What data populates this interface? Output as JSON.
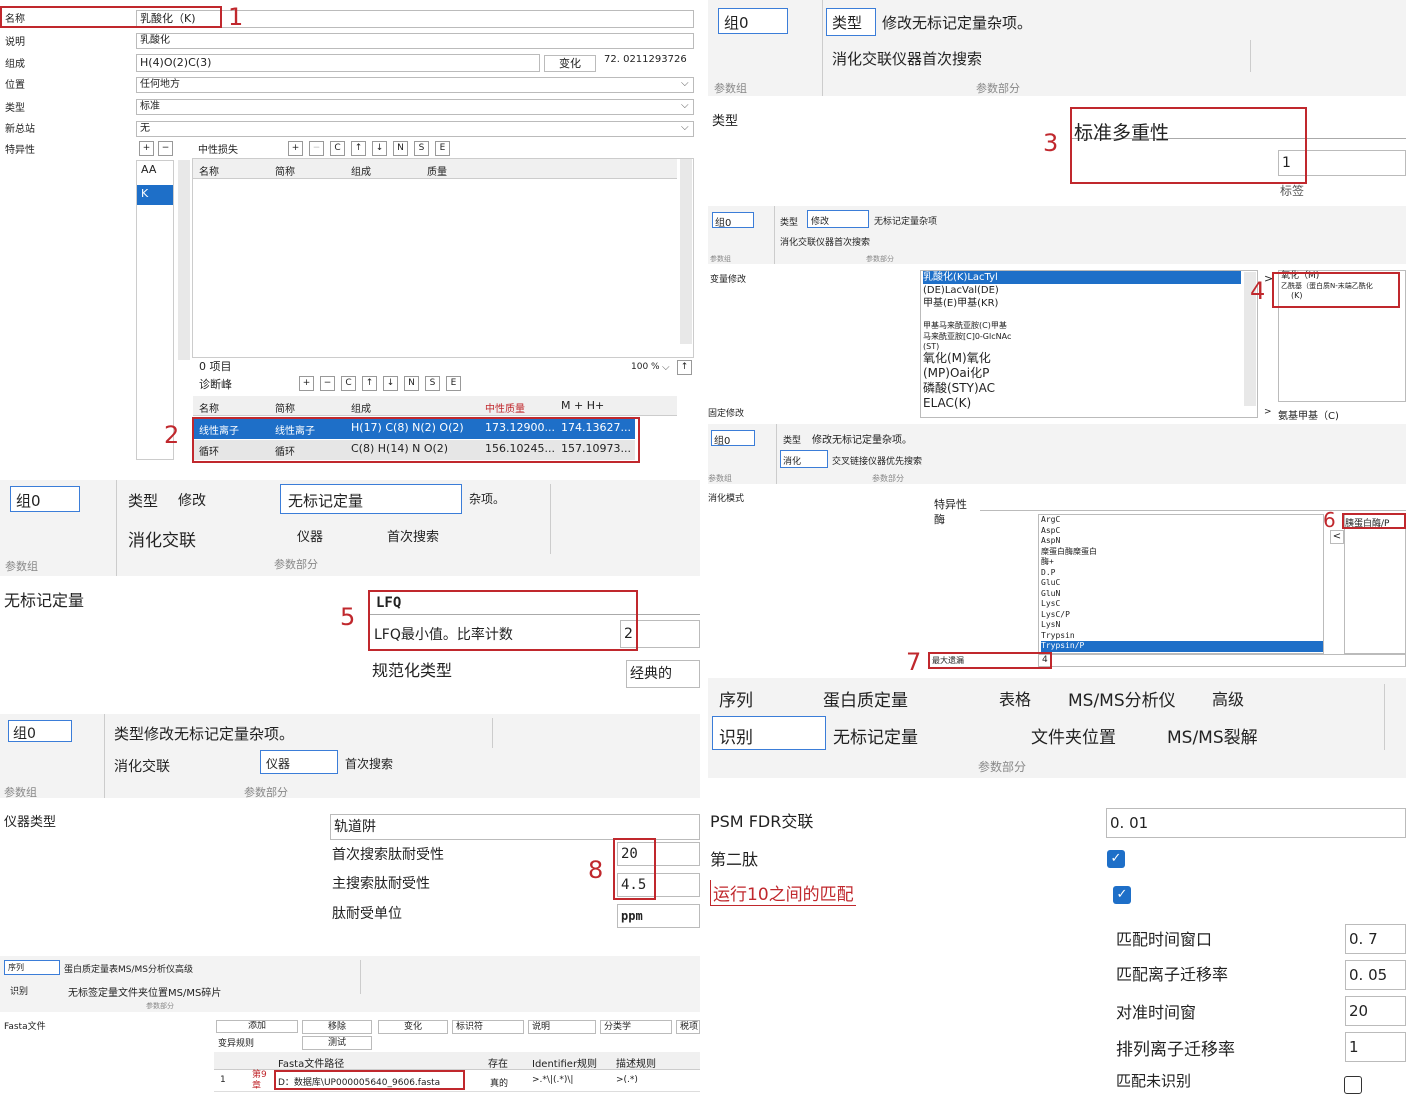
{
  "panel1": {
    "rows": [
      {
        "label": "名称",
        "value": "乳酸化（K)"
      },
      {
        "label": "说明",
        "value": "乳酸化"
      },
      {
        "label": "组成",
        "value": "H(4)O(2)C(3)"
      },
      {
        "label": "位置",
        "value": "任何地方"
      },
      {
        "label": "类型",
        "value": "标准"
      },
      {
        "label": "新总站",
        "value": "无"
      },
      {
        "label": "特异性",
        "value": ""
      }
    ],
    "change_button": "变化",
    "mass": "72. 0211293726",
    "neutral_loss_label": "中性损失",
    "aa_list": [
      "AA",
      "K"
    ],
    "toolbar_buttons": [
      "+",
      "−",
      "C",
      "↑",
      "↓",
      "N",
      "S",
      "E"
    ],
    "top_table_headers": [
      "名称",
      "简称",
      "组成",
      "质量"
    ],
    "item_count": "0 项目",
    "zoom": "100 %",
    "diag_label": "诊断峰",
    "diag_headers": [
      "名称",
      "简称",
      "组成",
      "中性质量",
      "M + H+"
    ],
    "diag_rows": [
      [
        "线性离子",
        "线性离子",
        "H(17) C(8) N(2) O(2)",
        "173.12900...",
        "174.13627..."
      ],
      [
        "循环",
        "循环",
        "C(8) H(14) N O(2)",
        "156.10245...",
        "157.10973..."
      ]
    ]
  },
  "panel2": {
    "group": "组0",
    "tab_type": "类型",
    "tab_rest": "修改无标记定量杂项。",
    "tab_row2": "消化交联仪器首次搜索",
    "param_group": "参数组",
    "param_part": "参数部分",
    "type_label": "类型",
    "multiplicity": "标准多重性",
    "mult_value": "1",
    "tag_label": "标签"
  },
  "panel3": {
    "group": "组0",
    "tab_type": "类型",
    "tab_modify": "修改",
    "tab_rest": "无标记定量杂项",
    "tab_row2": "消化交联仪器首次搜索",
    "param_group": "参数组",
    "param_part": "参数部分",
    "var_mod_label": "变量修改",
    "fixed_mod_label": "固定修改",
    "mod_list": [
      "乳酸化(K)LacTyl",
      "(DE)LacVal(DE)",
      "甲基(E)甲基(KR)",
      "甲基马来酰亚胺(C)甲基",
      "马来酰亚胺[C]0-GlcNAc",
      "(ST)",
      "氧化(M)氧化",
      "(MP)Oai化P",
      "磷酸(STY)AC",
      "ELAC(K)"
    ],
    "selected_list": [
      "氧化（M)",
      "乙酰基（蛋白质N-末端乙酰化",
      "(K)"
    ],
    "fixed_item": "氨基甲基（C)",
    "arrow_right": ">"
  },
  "panel4": {
    "group": "组0",
    "tab_type": "类型",
    "tab_rest": "修改无标记定量杂项。",
    "tab_digest": "消化",
    "tab_row2_rest": "交叉链接仪器优先搜索",
    "param_group": "参数组",
    "param_part": "参数部分",
    "digest_mode_label": "消化模式",
    "specificity_label": "特异性",
    "enzyme_label": "酶",
    "enzymes": [
      "ArgC",
      "AspC",
      "AspN",
      "糜蛋白酶糜蛋白",
      "酶+",
      "D.P",
      "GluC",
      "GluN",
      "LysC",
      "LysC/P",
      "LysN",
      "Trypsin",
      "Trypsin/P"
    ],
    "selected_enzyme": "胰蛋白酶/P",
    "max_missed_label": "最大遗漏",
    "max_missed_value": "4",
    "arrow_left": "<"
  },
  "panel5": {
    "group": "组0",
    "tab_type": "类型",
    "tab_modify": "修改",
    "tab_lfq": "无标记定量",
    "tab_misc": "杂项。",
    "tab_digest": "消化交联",
    "tab_instrument": "仪器",
    "tab_first": "首次搜索",
    "param_group": "参数组",
    "param_part": "参数部分",
    "section_label": "无标记定量",
    "lfq": "LFQ",
    "lfq_min_label": "LFQ最小值。比率计数",
    "lfq_min_value": "2",
    "norm_label": "规范化类型",
    "norm_value": "经典的"
  },
  "panel6": {
    "tabs_row1": [
      "序列",
      "蛋白质定量",
      "表格",
      "MS/MS分析仪",
      "高级"
    ],
    "tabs_row2": [
      "识别",
      "无标记定量",
      "文件夹位置",
      "MS/MS裂解"
    ],
    "param_part": "参数部分",
    "psm_fdr_label": "PSM FDR交联",
    "psm_fdr_value": "0. 01",
    "second_peptide_label": "第二肽",
    "match_between_label": "运行10之间的匹配",
    "match_time_label": "匹配时间窗口",
    "match_time_value": "0. 7",
    "match_ion_label": "匹配离子迁移率",
    "match_ion_value": "0. 05",
    "align_time_label": "对准时间窗",
    "align_time_value": "20",
    "align_ion_label": "排列离子迁移率",
    "align_ion_value": "1",
    "match_unid_label": "匹配未识别"
  },
  "panel7": {
    "group": "组0",
    "tab_row1": "类型修改无标记定量杂项。",
    "tab_digest": "消化交联",
    "tab_instrument": "仪器",
    "tab_first": "首次搜索",
    "param_group": "参数组",
    "param_part": "参数部分",
    "instrument_type_label": "仪器类型",
    "instrument_value": "轨道阱",
    "first_tol_label": "首次搜索肽耐受性",
    "first_tol_value": "20",
    "main_tol_label": "主搜索肽耐受性",
    "main_tol_value": "4.5",
    "unit_label": "肽耐受单位",
    "unit_value": "ppm"
  },
  "panel8": {
    "tab_seq": "序列",
    "tab_row1_rest": "蛋白质定量表MS/MS分析仪高级",
    "tab_id": "识别",
    "tab_row2_rest": "无标签定量文件夹位置MS/MS碎片",
    "param_part": "参数部分",
    "fasta_label": "Fasta文件",
    "buttons": [
      "添加",
      "移除",
      "变化",
      "标识符",
      "说明",
      "分类学",
      "税项"
    ],
    "variant_rule": "变异规则",
    "test_button": "测试",
    "headers": [
      "Fasta文件路径",
      "存在",
      "Identifier规则",
      "描述规则"
    ],
    "row_index": "1",
    "row_chapter": "第9章",
    "row_path": "D：数据库\\UP000005640_9606.fasta",
    "row_exists": "真的",
    "row_id_rule": ">.*\\|(.*)\\|",
    "row_desc_rule": ">(.*)"
  },
  "annotations": [
    "1",
    "2",
    "3",
    "4",
    "5",
    "6",
    "7",
    "8"
  ]
}
